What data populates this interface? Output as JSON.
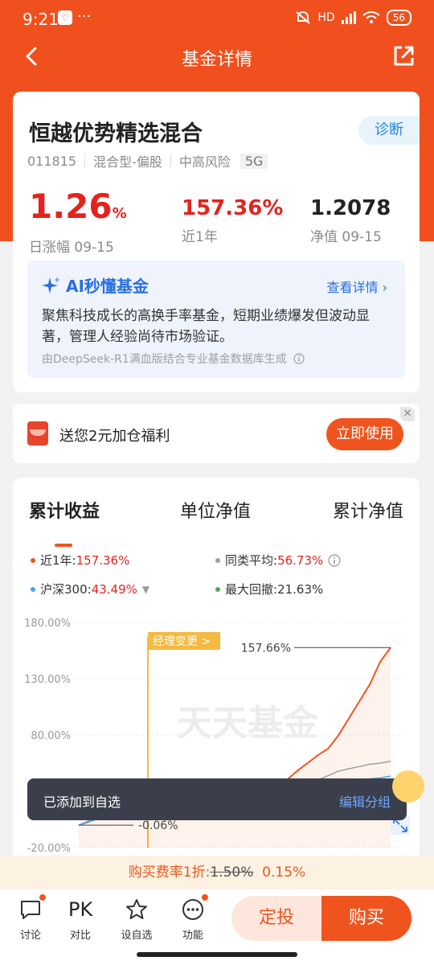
{
  "status_bar": {
    "time": "9:21",
    "app_icon_char": "♡",
    "dots": "···",
    "network": "HD",
    "battery": "56"
  },
  "nav": {
    "title": "基金详情"
  },
  "fund": {
    "name": "恒越优势精选混合",
    "diagnose_label": "诊断",
    "code": "011815",
    "type": "混合型-偏股",
    "risk": "中高风险",
    "rating": "5G",
    "daily_change_value": "1.26",
    "daily_change_unit": "%",
    "daily_change_label": "日涨幅 09-15",
    "year_return": "157.36%",
    "year_return_label": "近1年",
    "nav_value": "1.2078",
    "nav_label": "净值 09-15"
  },
  "ai": {
    "title": "AI秒懂基金",
    "more": "查看详情",
    "summary": "聚焦科技成长的高换手率基金，短期业绩爆发但波动显著，管理人经验尚待市场验证。",
    "source": "由DeepSeek-R1满血版结合专业基金数据库生成"
  },
  "promo": {
    "text": "送您2元加仓福利",
    "button": "立即使用",
    "close": "✕"
  },
  "chart_tabs": [
    "累计收益",
    "单位净值",
    "累计净值"
  ],
  "legend": {
    "year_label": "近1年:",
    "year_value": "157.36%",
    "peer_label": "同类平均:",
    "peer_value": "56.73%",
    "index_label": "沪深300:",
    "index_value": "43.49%",
    "drawdown_label": "最大回撤:",
    "drawdown_value": "21.63%"
  },
  "chart_data": {
    "type": "line",
    "title": "",
    "y_ticks": [
      "180.00%",
      "130.00%",
      "80.00%",
      "-20.00%"
    ],
    "ylim": [
      -20,
      180
    ],
    "annotations": {
      "event": "经理变更 >",
      "max": "157.66%",
      "min": "-0.06%"
    },
    "watermark": "天天基金",
    "series": [
      {
        "name": "近1年",
        "color": "#f0541e",
        "values": [
          -0.06,
          3,
          8,
          12,
          18,
          22,
          20,
          25,
          28,
          24,
          22,
          26,
          30,
          28,
          25,
          27,
          30,
          32,
          30,
          34,
          40,
          48,
          55,
          62,
          68,
          80,
          95,
          110,
          125,
          145,
          157.66
        ]
      },
      {
        "name": "同类平均",
        "color": "#9e9e9e",
        "values": [
          0,
          4,
          7,
          10,
          14,
          18,
          17,
          20,
          22,
          20,
          19,
          22,
          24,
          23,
          22,
          23,
          25,
          26,
          25,
          27,
          30,
          33,
          36,
          40,
          44,
          48,
          50,
          52,
          54,
          55,
          56.73
        ]
      },
      {
        "name": "沪深300",
        "color": "#42a5f5",
        "values": [
          0,
          3,
          6,
          9,
          12,
          15,
          14,
          16,
          18,
          16,
          15,
          17,
          19,
          18,
          17,
          18,
          20,
          21,
          20,
          22,
          25,
          27,
          30,
          32,
          34,
          36,
          38,
          40,
          41,
          42,
          43.49
        ]
      }
    ]
  },
  "toast": {
    "message": "已添加到自选",
    "action": "编辑分组"
  },
  "fee": {
    "label": "购买费率1折:",
    "old": "1.50%",
    "new": "0.15%"
  },
  "bottom": {
    "discuss": "讨论",
    "compare_icon": "PK",
    "compare": "对比",
    "watchlist": "设自选",
    "functions": "功能",
    "auto_invest": "定投",
    "buy": "购买"
  },
  "colors": {
    "brand": "#f0501e",
    "up": "#e4231d",
    "ai_blue": "#2a6fe0"
  }
}
